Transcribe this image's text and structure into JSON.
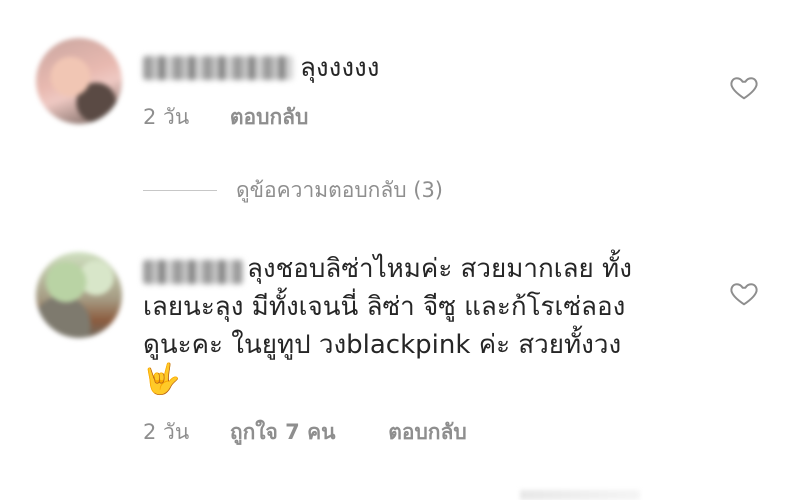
{
  "comments": [
    {
      "text": "ลุงงงงง",
      "time": "2 วัน",
      "reply_label": "ตอบกลับ",
      "likes_label": ""
    },
    {
      "text_line1": "ลุงชอบลิซ่าไหมค่ะ สวยมากเลย ทั้ง",
      "text_rest": "เลยนะลุง มีทั้งเจนนี่ ลิซ่า จีซู และก้โรเซ่ลอง\nดูนะคะ ในยูทูป วงblackpink ค่ะ สวยทั้งวง",
      "emoji": "🤟",
      "time": "2 วัน",
      "likes_label": "ถูกใจ 7 คน",
      "reply_label": "ตอบกลับ"
    }
  ],
  "view_replies": {
    "label": "ดูข้อความตอบกลับ (3)"
  },
  "icons": {
    "like": "heart-icon"
  },
  "colors": {
    "text": "#262626",
    "secondary": "#8e8e8e",
    "divider": "#c7c7c7"
  }
}
